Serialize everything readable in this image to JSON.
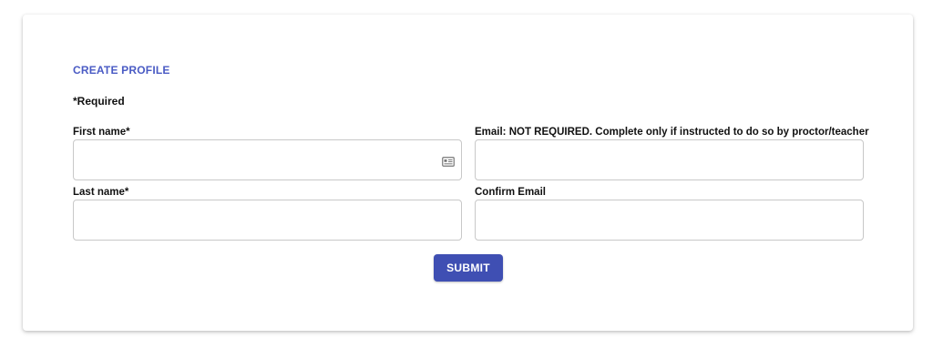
{
  "form": {
    "title": "CREATE PROFILE",
    "required_note": "*Required",
    "first_name": {
      "label": "First name*",
      "value": ""
    },
    "last_name": {
      "label": "Last name*",
      "value": ""
    },
    "email": {
      "label": "Email: NOT REQUIRED. Complete only if instructed to do so by proctor/teacher",
      "value": ""
    },
    "confirm_email": {
      "label": "Confirm Email",
      "value": ""
    },
    "submit_label": "SUBMIT",
    "autofill_icon": "contact-card-icon"
  },
  "colors": {
    "accent": "#4a5bc4",
    "button": "#3f4fb3",
    "input_border": "#c8c8c8"
  }
}
